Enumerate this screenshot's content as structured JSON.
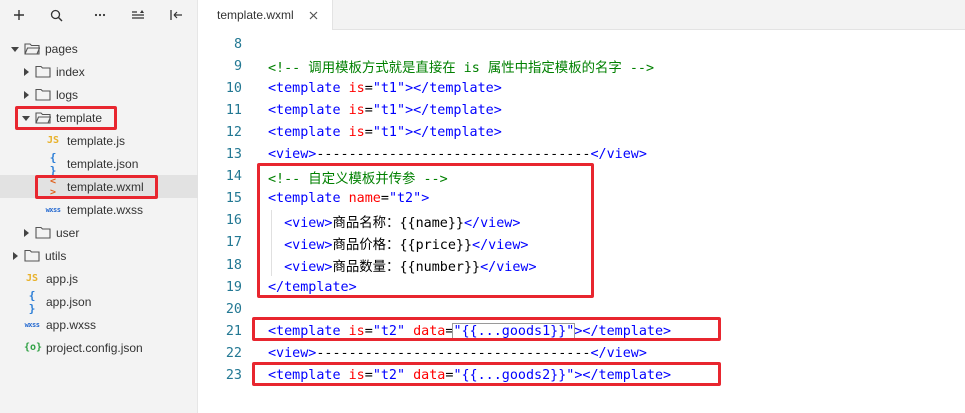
{
  "sidebar": {
    "toolbar": [
      "add-icon",
      "search-icon",
      "more-icon",
      "collapse-icon",
      "split-icon"
    ],
    "tree": [
      {
        "label": "pages",
        "kind": "folder",
        "expanded": true
      },
      {
        "label": "index",
        "kind": "folder",
        "expanded": false
      },
      {
        "label": "logs",
        "kind": "folder",
        "expanded": false
      },
      {
        "label": "template",
        "kind": "folder",
        "expanded": true
      },
      {
        "label": "template.js",
        "kind": "file",
        "icon": "JS"
      },
      {
        "label": "template.json",
        "kind": "file",
        "icon": "{ }"
      },
      {
        "label": "template.wxml",
        "kind": "file",
        "icon": "< >",
        "selected": true
      },
      {
        "label": "template.wxss",
        "kind": "file",
        "icon": "wxss"
      },
      {
        "label": "user",
        "kind": "folder",
        "expanded": false
      },
      {
        "label": "utils",
        "kind": "folder",
        "expanded": false
      },
      {
        "label": "app.js",
        "kind": "file",
        "icon": "JS"
      },
      {
        "label": "app.json",
        "kind": "file",
        "icon": "{ }"
      },
      {
        "label": "app.wxss",
        "kind": "file",
        "icon": "wxss"
      },
      {
        "label": "project.config.json",
        "kind": "file",
        "icon": "{o}"
      }
    ]
  },
  "editor": {
    "tab_label": "template.wxml",
    "lines": [
      {
        "n": "8",
        "parts": []
      },
      {
        "n": "9",
        "parts": [
          [
            "comment",
            "<!-- 调用模板方式就是直接在 is 属性中指定模板的名字 -->"
          ]
        ]
      },
      {
        "n": "10",
        "parts": [
          [
            "tag",
            "<template "
          ],
          [
            "attr",
            "is"
          ],
          [
            "text",
            "="
          ],
          [
            "val",
            "\"t1\""
          ],
          [
            "tag",
            "></template>"
          ]
        ]
      },
      {
        "n": "11",
        "parts": [
          [
            "tag",
            "<template "
          ],
          [
            "attr",
            "is"
          ],
          [
            "text",
            "="
          ],
          [
            "val",
            "\"t1\""
          ],
          [
            "tag",
            "></template>"
          ]
        ]
      },
      {
        "n": "12",
        "parts": [
          [
            "tag",
            "<template "
          ],
          [
            "attr",
            "is"
          ],
          [
            "text",
            "="
          ],
          [
            "val",
            "\"t1\""
          ],
          [
            "tag",
            "></template>"
          ]
        ]
      },
      {
        "n": "13",
        "parts": [
          [
            "tag",
            "<view>"
          ],
          [
            "text",
            "----------------------------------"
          ],
          [
            "tag",
            "</view>"
          ]
        ]
      },
      {
        "n": "14",
        "parts": [
          [
            "comment",
            "<!-- 自定义模板并传参 -->"
          ]
        ]
      },
      {
        "n": "15",
        "parts": [
          [
            "tag",
            "<template "
          ],
          [
            "attr",
            "name"
          ],
          [
            "text",
            "="
          ],
          [
            "val",
            "\"t2\""
          ],
          [
            "tag",
            ">"
          ]
        ]
      },
      {
        "n": "16",
        "parts": [
          [
            "text",
            "  "
          ],
          [
            "tag",
            "<view>"
          ],
          [
            "text",
            "商品名称：{{name}}"
          ],
          [
            "tag",
            "</view>"
          ]
        ]
      },
      {
        "n": "17",
        "parts": [
          [
            "text",
            "  "
          ],
          [
            "tag",
            "<view>"
          ],
          [
            "text",
            "商品价格：{{price}}"
          ],
          [
            "tag",
            "</view>"
          ]
        ]
      },
      {
        "n": "18",
        "parts": [
          [
            "text",
            "  "
          ],
          [
            "tag",
            "<view>"
          ],
          [
            "text",
            "商品数量：{{number}}"
          ],
          [
            "tag",
            "</view>"
          ]
        ]
      },
      {
        "n": "19",
        "parts": [
          [
            "tag",
            "</template>"
          ]
        ]
      },
      {
        "n": "20",
        "parts": []
      },
      {
        "n": "21",
        "parts": [
          [
            "tag",
            "<template "
          ],
          [
            "attr",
            "is"
          ],
          [
            "text",
            "="
          ],
          [
            "val",
            "\"t2\""
          ],
          [
            "text",
            " "
          ],
          [
            "attr",
            "data"
          ],
          [
            "text",
            "="
          ],
          [
            "val",
            "\"{{...goods1}}\""
          ],
          [
            "tag",
            "></template>"
          ]
        ]
      },
      {
        "n": "22",
        "parts": [
          [
            "tag",
            "<view>"
          ],
          [
            "text",
            "----------------------------------"
          ],
          [
            "tag",
            "</view>"
          ]
        ]
      },
      {
        "n": "23",
        "parts": [
          [
            "tag",
            "<template "
          ],
          [
            "attr",
            "is"
          ],
          [
            "text",
            "="
          ],
          [
            "val",
            "\"t2\""
          ],
          [
            "text",
            " "
          ],
          [
            "attr",
            "data"
          ],
          [
            "text",
            "="
          ],
          [
            "val",
            "\"{{...goods2}}\""
          ],
          [
            "tag",
            "></template>"
          ]
        ]
      }
    ]
  },
  "colors": {
    "annotation": "#e8262f",
    "line_number": "#237893",
    "tag": "#0000ff",
    "attribute": "#ff0000",
    "comment": "#008000"
  }
}
